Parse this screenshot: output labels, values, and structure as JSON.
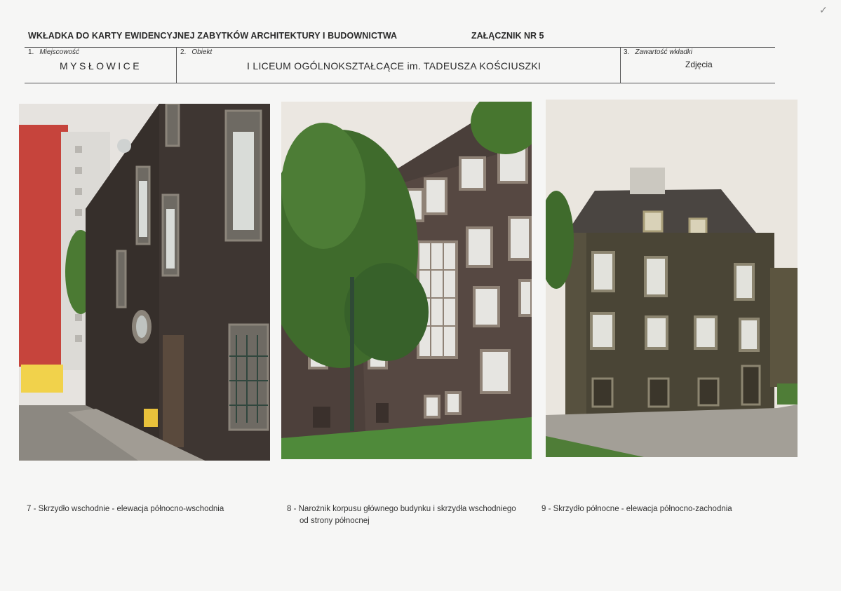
{
  "header": {
    "title": "WKŁADKA DO KARTY EWIDENCYJNEJ ZABYTKÓW ARCHITEKTURY I BUDOWNICTWA",
    "annex": "ZAŁĄCZNIK NR  5"
  },
  "fields": {
    "place": {
      "number": "1.",
      "label": "Miejscowość",
      "value": "MYSŁOWICE"
    },
    "object": {
      "number": "2.",
      "label": "Obiekt",
      "value": "I LICEUM OGÓLNOKSZTAŁCĄCE im. TADEUSZA KOŚCIUSZKI"
    },
    "contents": {
      "number": "3.",
      "label": "Zawartość wkładki",
      "value": "Zdjęcia"
    }
  },
  "photos": [
    {
      "caption": "7 - Skrzydło wschodnie - elewacja północno-wschodnia"
    },
    {
      "caption_line1": "8 - Narożnik korpusu głównego budynku i skrzydła wschodniego",
      "caption_line2": "od strony północnej"
    },
    {
      "caption": "9 - Skrzydło północne - elewacja północno-zachodnia"
    }
  ],
  "colors": {
    "wall_dark": "#3e3632",
    "wall_olive": "#4a4536",
    "sky": "#e8e4de",
    "foliage": "#3f6b2c",
    "grass": "#4f8a3a",
    "red_block": "#c6443c"
  }
}
